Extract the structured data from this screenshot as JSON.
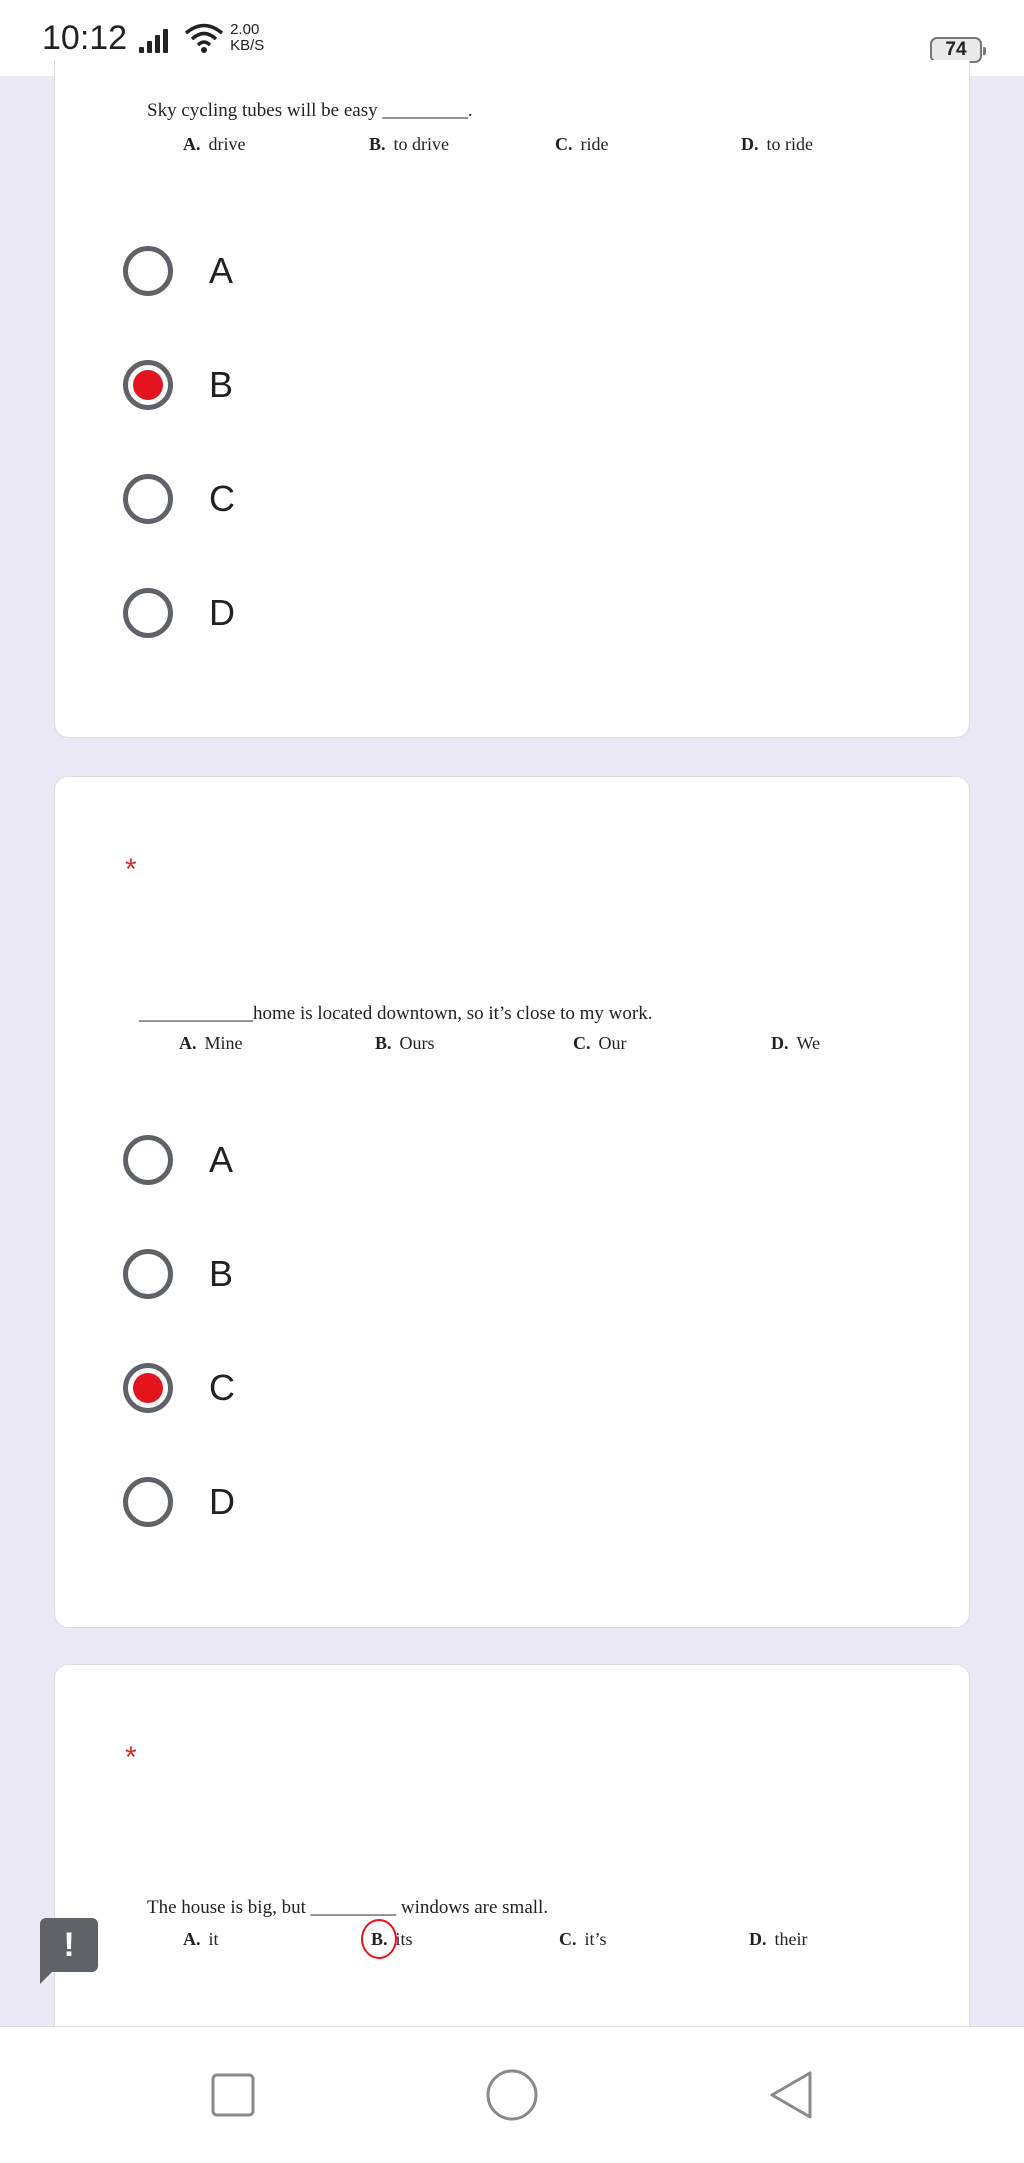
{
  "status_bar": {
    "time": "10:12",
    "net_speed_value": "2.00",
    "net_speed_unit": "KB/S",
    "battery": "74"
  },
  "questions": [
    {
      "required": false,
      "sentence": "Sky cycling tubes will be easy _________.",
      "choices": [
        {
          "letter": "A.",
          "text": "drive"
        },
        {
          "letter": "B.",
          "text": "to drive"
        },
        {
          "letter": "C.",
          "text": "ride"
        },
        {
          "letter": "D.",
          "text": "to ride"
        }
      ],
      "options": [
        "A",
        "B",
        "C",
        "D"
      ],
      "selected": "B"
    },
    {
      "required": true,
      "star": "*",
      "sentence": "____________home is located downtown, so it’s close to my work.",
      "choices": [
        {
          "letter": "A.",
          "text": "Mine"
        },
        {
          "letter": "B.",
          "text": "Ours"
        },
        {
          "letter": "C.",
          "text": "Our"
        },
        {
          "letter": "D.",
          "text": "We"
        }
      ],
      "options": [
        "A",
        "B",
        "C",
        "D"
      ],
      "selected": "C"
    },
    {
      "required": true,
      "star": "*",
      "sentence": "The house is big, but _________ windows are small.",
      "choices": [
        {
          "letter": "A.",
          "text": "it"
        },
        {
          "letter": "B.",
          "text": "its"
        },
        {
          "letter": "C.",
          "text": "it’s"
        },
        {
          "letter": "D.",
          "text": "their"
        }
      ],
      "marked_choice": "B."
    }
  ],
  "feedback_button": {
    "icon": "exclamation-icon",
    "glyph": "!"
  },
  "nav_bar": {
    "items": [
      "recents-square-icon",
      "home-circle-icon",
      "back-triangle-icon"
    ]
  },
  "colors": {
    "selected_radio": "#e4141e",
    "required_star": "#d93025",
    "page_bg": "#ece9f6"
  }
}
